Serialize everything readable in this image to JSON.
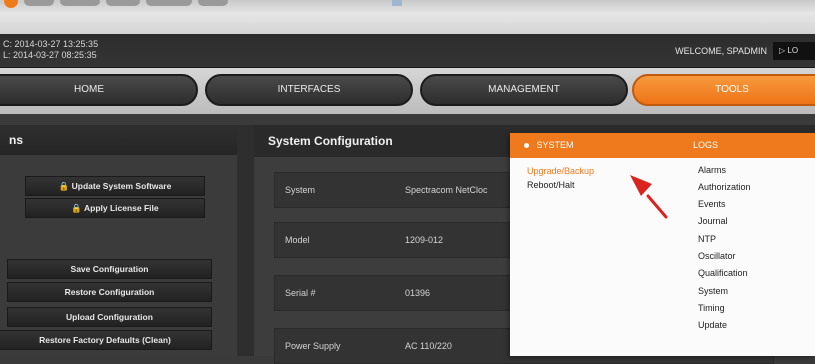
{
  "clock": {
    "line1": "C: 2014-03-27 13:25:35",
    "line2": "L: 2014-03-27 08:25:35"
  },
  "header": {
    "welcome": "WELCOME, SPADMIN",
    "logout_label": "LO"
  },
  "nav": {
    "tabs": [
      {
        "label": "HOME"
      },
      {
        "label": "INTERFACES"
      },
      {
        "label": "MANAGEMENT"
      },
      {
        "label": "TOOLS"
      }
    ],
    "active": "TOOLS"
  },
  "left_panel": {
    "title": "ns",
    "buttons": [
      {
        "label": "Update System Software",
        "icon": "lock-icon"
      },
      {
        "label": "Apply License File",
        "icon": "lock-icon"
      },
      {
        "label": "Save Configuration"
      },
      {
        "label": "Restore Configuration"
      },
      {
        "label": "Upload Configuration"
      },
      {
        "label": "Restore Factory Defaults (Clean)"
      }
    ]
  },
  "main_panel": {
    "title": "System Configuration",
    "rows": [
      {
        "key": "System",
        "value": "Spectracom NetCloc"
      },
      {
        "key": "Model",
        "value": "1209-012"
      },
      {
        "key": "Serial #",
        "value": "01396"
      },
      {
        "key": "Power Supply",
        "value": "AC 110/220"
      }
    ]
  },
  "dropdown": {
    "system_header": "SYSTEM",
    "logs_header": "LOGS",
    "system_items": [
      "Upgrade/Backup",
      "Reboot/Halt"
    ],
    "highlighted_item": "Upgrade/Backup",
    "logs_items": [
      "Alarms",
      "Authorization",
      "Events",
      "Journal",
      "NTP",
      "Oscillator",
      "Qualification",
      "System",
      "Timing",
      "Update"
    ]
  },
  "colors": {
    "accent": "#ef7a1d",
    "annotation_arrow": "#d9251d",
    "panel_dark": "#2a2a2a"
  }
}
